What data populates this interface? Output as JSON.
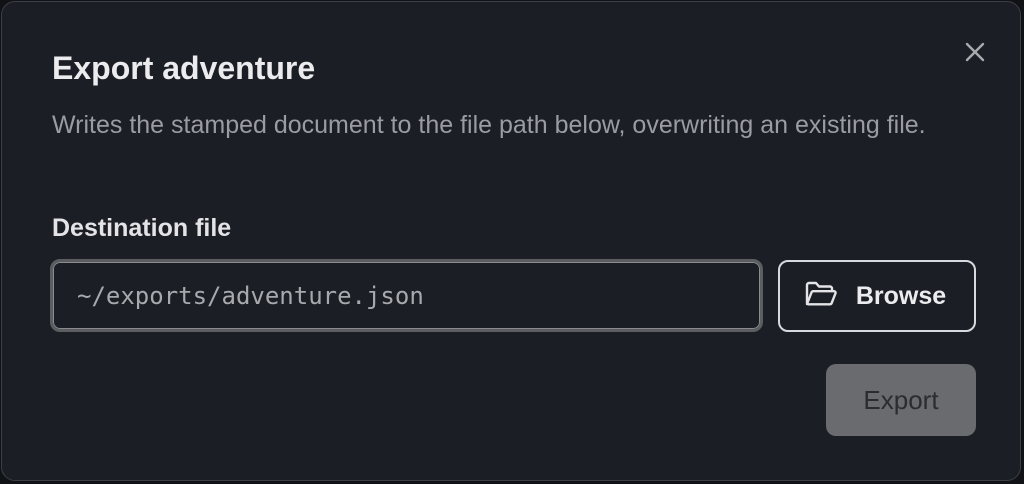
{
  "dialog": {
    "title": "Export adventure",
    "description": "Writes the stamped document to the file path below, overwriting an existing file.",
    "close_icon": "close-icon"
  },
  "destination": {
    "label": "Destination file",
    "value": "~/exports/adventure.json",
    "placeholder": ""
  },
  "browse": {
    "label": "Browse",
    "icon": "folder-open-icon"
  },
  "export": {
    "label": "Export",
    "disabled": true
  },
  "colors": {
    "background": "#1b1e25",
    "border": "#3c3f46",
    "text_primary": "#ececee",
    "text_secondary": "#9b9ca2",
    "export_button_bg": "#6a6b6f"
  }
}
